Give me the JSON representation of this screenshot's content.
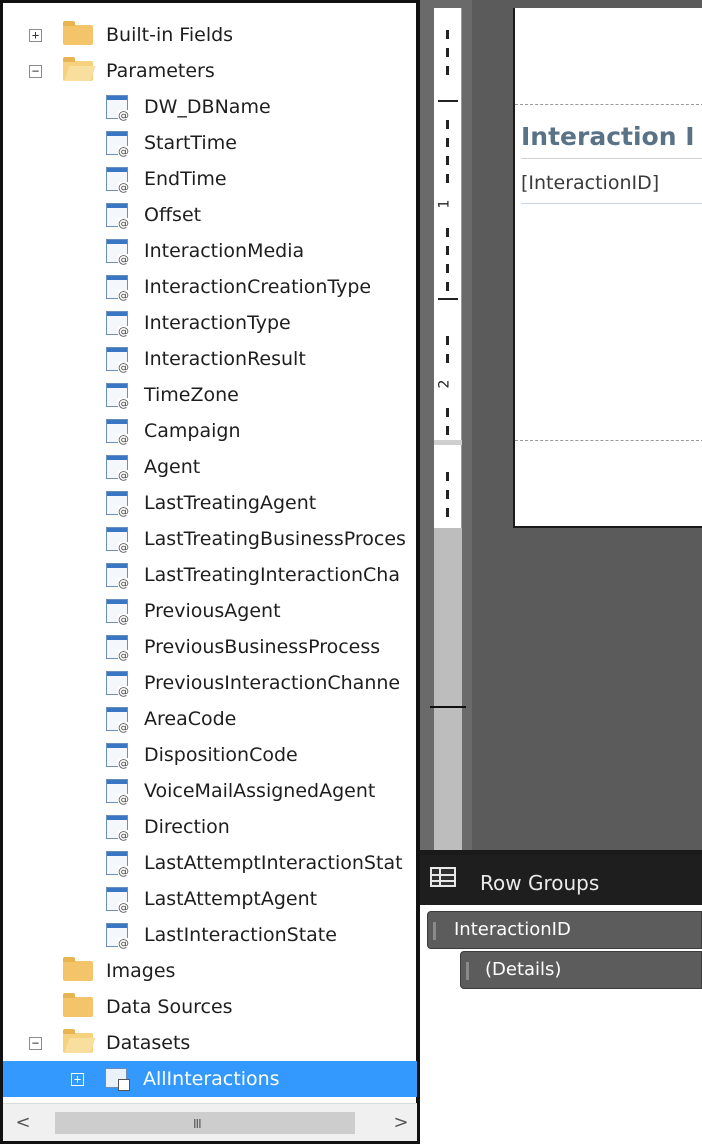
{
  "tree": {
    "items": [
      {
        "label": "Built-in Fields",
        "expander": "+",
        "icon": "folder-icon"
      },
      {
        "label": "Parameters",
        "expander": "−",
        "icon": "folder-open-icon"
      },
      {
        "label": "DW_DBName",
        "icon": "parameter-icon"
      },
      {
        "label": "StartTime",
        "icon": "parameter-icon"
      },
      {
        "label": "EndTime",
        "icon": "parameter-icon"
      },
      {
        "label": "Offset",
        "icon": "parameter-icon"
      },
      {
        "label": "InteractionMedia",
        "icon": "parameter-icon"
      },
      {
        "label": "InteractionCreationType",
        "icon": "parameter-icon"
      },
      {
        "label": "InteractionType",
        "icon": "parameter-icon"
      },
      {
        "label": "InteractionResult",
        "icon": "parameter-icon"
      },
      {
        "label": "TimeZone",
        "icon": "parameter-icon"
      },
      {
        "label": "Campaign",
        "icon": "parameter-icon"
      },
      {
        "label": "Agent",
        "icon": "parameter-icon"
      },
      {
        "label": "LastTreatingAgent",
        "icon": "parameter-icon"
      },
      {
        "label": "LastTreatingBusinessProces",
        "icon": "parameter-icon"
      },
      {
        "label": "LastTreatingInteractionCha",
        "icon": "parameter-icon"
      },
      {
        "label": "PreviousAgent",
        "icon": "parameter-icon"
      },
      {
        "label": "PreviousBusinessProcess",
        "icon": "parameter-icon"
      },
      {
        "label": "PreviousInteractionChanne",
        "icon": "parameter-icon"
      },
      {
        "label": "AreaCode",
        "icon": "parameter-icon"
      },
      {
        "label": "DispositionCode",
        "icon": "parameter-icon"
      },
      {
        "label": "VoiceMailAssignedAgent",
        "icon": "parameter-icon"
      },
      {
        "label": "Direction",
        "icon": "parameter-icon"
      },
      {
        "label": "LastAttemptInteractionStat",
        "icon": "parameter-icon"
      },
      {
        "label": "LastAttemptAgent",
        "icon": "parameter-icon"
      },
      {
        "label": "LastInteractionState",
        "icon": "parameter-icon"
      },
      {
        "label": "Images",
        "icon": "folder-icon"
      },
      {
        "label": "Data Sources",
        "icon": "folder-icon"
      },
      {
        "label": "Datasets",
        "expander": "−",
        "icon": "folder-open-icon"
      },
      {
        "label": "AllInteractions",
        "expander": "+",
        "icon": "dataset-icon",
        "selected": true
      }
    ]
  },
  "scrollbar": {
    "left_arrow": "<",
    "right_arrow": ">",
    "grip": "III"
  },
  "ruler": {
    "labels": [
      "1",
      "2"
    ]
  },
  "report": {
    "header_text": "Interaction I",
    "detail_text": "[InteractionID]"
  },
  "row_groups": {
    "title": "Row Groups",
    "groups": [
      {
        "label": "InteractionID"
      },
      {
        "label": "(Details)"
      }
    ]
  },
  "colors": {
    "selection": "#3399ff",
    "header_text": "#5a7286",
    "canvas": "#5b5b5b"
  }
}
